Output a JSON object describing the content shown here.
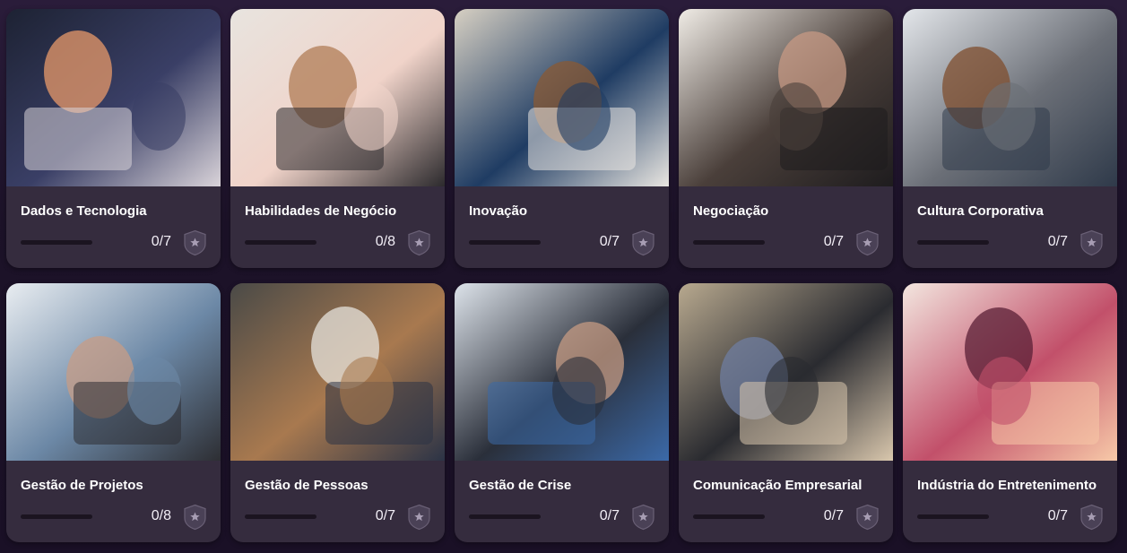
{
  "courses": [
    {
      "title": "Dados e Tecnologia",
      "progress": "0/7",
      "completed": 0,
      "total": 7,
      "image": "tech-hand-tablet",
      "colors": [
        "#1d2233",
        "#3a3f66",
        "#e89a6a",
        "#d9d3d9"
      ]
    },
    {
      "title": "Habilidades de Negócio",
      "progress": "0/8",
      "completed": 0,
      "total": 8,
      "image": "woman-presenting-meeting",
      "colors": [
        "#e8e4df",
        "#f0d3c9",
        "#b07c55",
        "#2c2a2d"
      ]
    },
    {
      "title": "Inovação",
      "progress": "0/7",
      "completed": 0,
      "total": 7,
      "image": "laptop-website-desk",
      "colors": [
        "#d7d0c3",
        "#1f3c63",
        "#8a5a34",
        "#e9e6e1"
      ]
    },
    {
      "title": "Negociação",
      "progress": "0/7",
      "completed": 0,
      "total": 7,
      "image": "handshake",
      "colors": [
        "#f0ece6",
        "#4a3f3a",
        "#c79a84",
        "#1e1c1e"
      ]
    },
    {
      "title": "Cultura Corporativa",
      "progress": "0/7",
      "completed": 0,
      "total": 7,
      "image": "team-high-five-office",
      "colors": [
        "#e3e6ea",
        "#6b6f77",
        "#7f4d2e",
        "#2f3a4a"
      ]
    },
    {
      "title": "Gestão de Projetos",
      "progress": "0/8",
      "completed": 0,
      "total": 8,
      "image": "hands-drawing-plans",
      "colors": [
        "#e9edf1",
        "#6c88a6",
        "#c79c86",
        "#2d2e33"
      ]
    },
    {
      "title": "Gestão de Pessoas",
      "progress": "0/7",
      "completed": 0,
      "total": 7,
      "image": "team-meeting-laptop-chart",
      "colors": [
        "#4a4a47",
        "#a8794f",
        "#e6e3dc",
        "#2b3346"
      ]
    },
    {
      "title": "Gestão de Crise",
      "progress": "0/7",
      "completed": 0,
      "total": 7,
      "image": "man-glasses-laptop",
      "colors": [
        "#dde3ea",
        "#2a2f3a",
        "#c59b83",
        "#3b69a8"
      ]
    },
    {
      "title": "Comunicação Empresarial",
      "progress": "0/7",
      "completed": 0,
      "total": 7,
      "image": "video-call-laptop",
      "colors": [
        "#b8a98f",
        "#2a2b30",
        "#6f7ea0",
        "#d9c7ad"
      ]
    },
    {
      "title": "Indústria do Entretenimento",
      "progress": "0/7",
      "completed": 0,
      "total": 7,
      "image": "concert-crowd",
      "colors": [
        "#f3e6df",
        "#c2506a",
        "#5a1f35",
        "#f7c9a8"
      ]
    }
  ],
  "badge_icon": "star-shield-icon",
  "theme": {
    "background": "#1d1329",
    "card": "#352c3e",
    "accent": "#8b6bd6"
  }
}
